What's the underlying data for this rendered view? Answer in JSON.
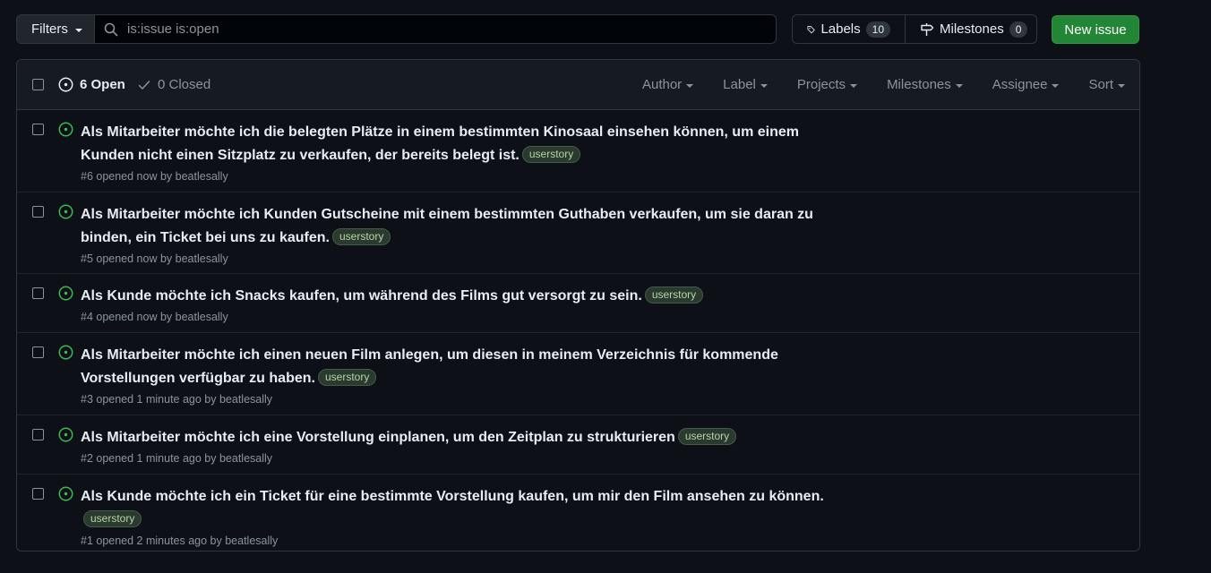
{
  "toolbar": {
    "filters_label": "Filters",
    "search_value": "is:issue is:open",
    "labels_label": "Labels",
    "labels_count": "10",
    "milestones_label": "Milestones",
    "milestones_count": "0",
    "new_issue_label": "New issue"
  },
  "header": {
    "open_label": "6 Open",
    "closed_label": "0 Closed",
    "filters": [
      "Author",
      "Label",
      "Projects",
      "Milestones",
      "Assignee",
      "Sort"
    ]
  },
  "colors": {
    "open_icon": "#3fb950",
    "new_issue_bg": "#238636",
    "label_bg": "#2b3a2e"
  },
  "issues": [
    {
      "title": "Als Mitarbeiter möchte ich die belegten Plätze in einem bestimmten Kinosaal einsehen können, um einem Kunden nicht einen Sitzplatz zu verkaufen, der bereits belegt ist.",
      "label": "userstory",
      "meta": "#6 opened now by beatlesally"
    },
    {
      "title": "Als Mitarbeiter möchte ich Kunden Gutscheine mit einem bestimmten Guthaben verkaufen, um sie daran zu binden, ein Ticket bei uns zu kaufen.",
      "label": "userstory",
      "meta": "#5 opened now by beatlesally"
    },
    {
      "title": "Als Kunde möchte ich Snacks kaufen, um während des Films gut versorgt zu sein.",
      "label": "userstory",
      "meta": "#4 opened now by beatlesally"
    },
    {
      "title": "Als Mitarbeiter möchte ich einen neuen Film anlegen, um diesen in meinem Verzeichnis für kommende Vorstellungen verfügbar zu haben.",
      "label": "userstory",
      "meta": "#3 opened 1 minute ago by beatlesally"
    },
    {
      "title": "Als Mitarbeiter möchte ich eine Vorstellung einplanen, um den Zeitplan zu strukturieren",
      "label": "userstory",
      "meta": "#2 opened 1 minute ago by beatlesally"
    },
    {
      "title": "Als Kunde möchte ich ein Ticket für eine bestimmte Vorstellung kaufen, um mir den Film ansehen zu können.",
      "label": "userstory",
      "meta": "#1 opened 2 minutes ago by beatlesally"
    }
  ]
}
